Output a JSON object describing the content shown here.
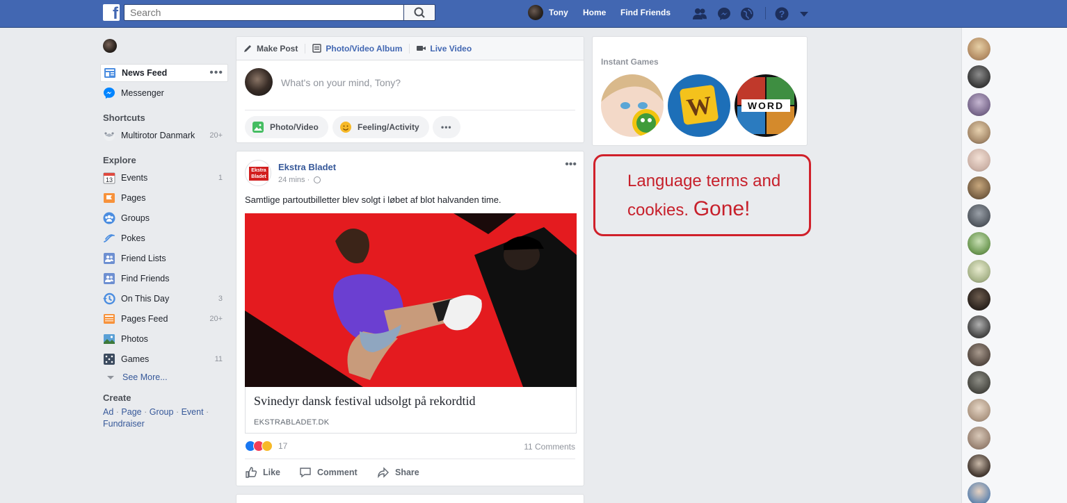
{
  "topbar": {
    "search_placeholder": "Search",
    "user_name": "Tony",
    "home_label": "Home",
    "find_friends_label": "Find Friends",
    "brand_color": "#4267b2"
  },
  "left_nav": {
    "items": [
      {
        "label": "News Feed"
      },
      {
        "label": "Messenger"
      }
    ],
    "shortcuts_header": "Shortcuts",
    "shortcuts": [
      {
        "label": "Multirotor Danmark",
        "count": "20+"
      }
    ],
    "explore_header": "Explore",
    "explore": [
      {
        "label": "Events",
        "count": "1",
        "icon": "calendar-icon",
        "date": "13"
      },
      {
        "label": "Pages",
        "count": "",
        "icon": "flag-icon"
      },
      {
        "label": "Groups",
        "count": "",
        "icon": "groups-icon"
      },
      {
        "label": "Pokes",
        "count": "",
        "icon": "poke-icon"
      },
      {
        "label": "Friend Lists",
        "count": "",
        "icon": "friend-list-icon"
      },
      {
        "label": "Find Friends",
        "count": "",
        "icon": "find-friends-icon"
      },
      {
        "label": "On This Day",
        "count": "3",
        "icon": "history-icon"
      },
      {
        "label": "Pages Feed",
        "count": "20+",
        "icon": "pages-feed-icon"
      },
      {
        "label": "Photos",
        "count": "",
        "icon": "photos-icon"
      },
      {
        "label": "Games",
        "count": "11",
        "icon": "games-icon"
      }
    ],
    "see_more": "See More...",
    "create_header": "Create",
    "create_links": [
      "Ad",
      "Page",
      "Group",
      "Event",
      "Fundraiser"
    ]
  },
  "composer": {
    "tabs": [
      "Make Post",
      "Photo/Video Album",
      "Live Video"
    ],
    "placeholder": "What's on your mind, Tony?",
    "buttons": [
      "Photo/Video",
      "Feeling/Activity",
      "•••"
    ]
  },
  "post": {
    "author": "Ekstra Bladet",
    "logo_text": "Ekstra Bladet",
    "time": "24 mins ·",
    "text": "Samtlige partoutbilletter blev solgt i løbet af blot halvanden time.",
    "link_title": "Svinedyr dansk festival udsolgt på rekordtid",
    "link_source": "EKSTRABLADET.DK",
    "reaction_count": "17",
    "comments": "11 Comments",
    "actions": [
      "Like",
      "Comment",
      "Share"
    ]
  },
  "right": {
    "games_header": "Instant Games",
    "annotation_line1": "Language terms and",
    "annotation_line2": "cookies.",
    "annotation_big": "Gone!",
    "annotation_color": "#d0202a"
  }
}
